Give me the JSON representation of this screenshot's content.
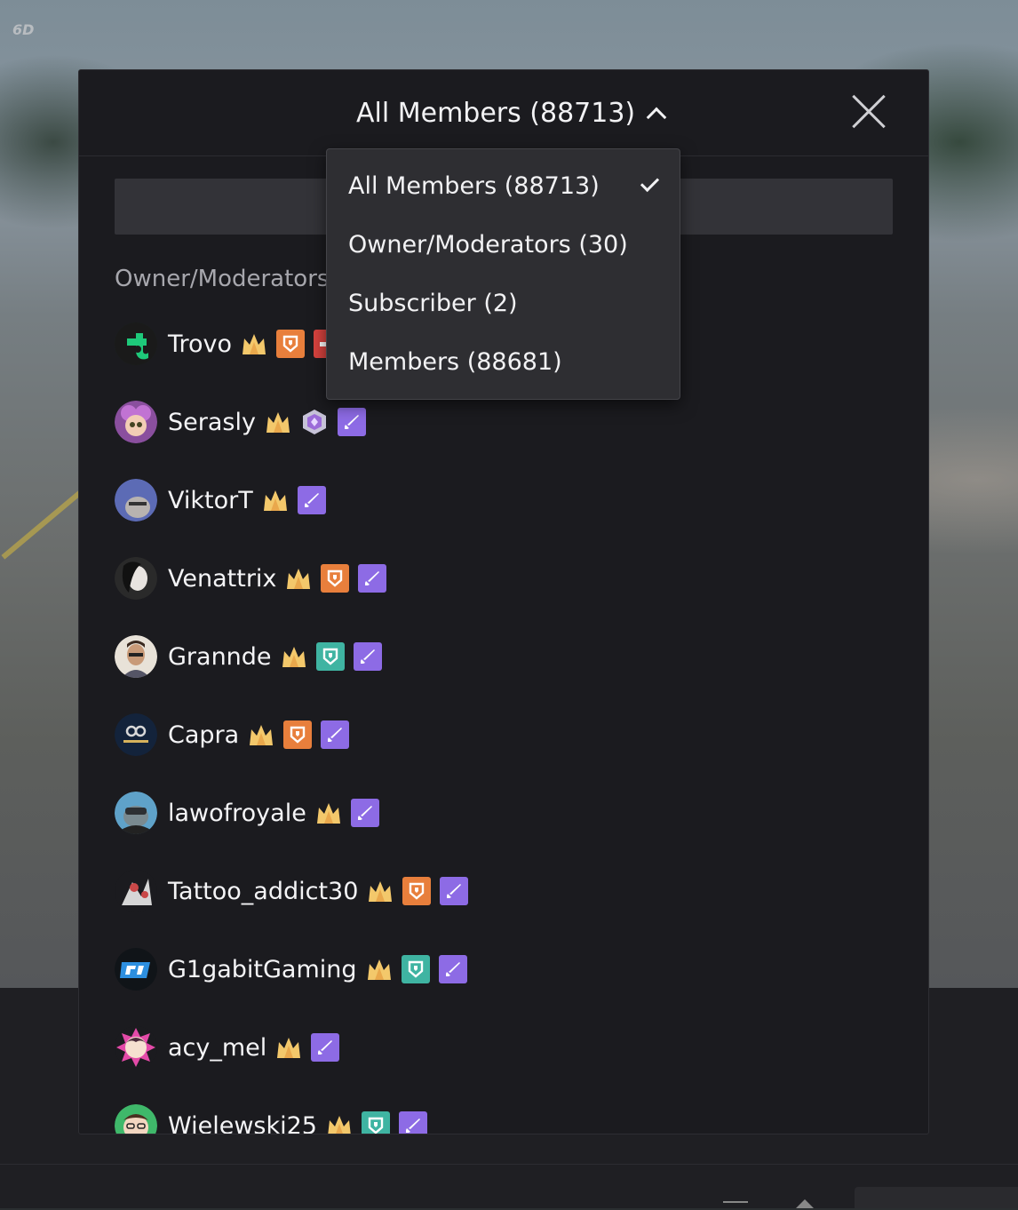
{
  "background": {
    "logo_text": "6D"
  },
  "modal": {
    "filter_label": "All Members (88713)",
    "section_title": "Owner/Moderators"
  },
  "dropdown": {
    "options": [
      {
        "label": "All Members (88713)",
        "selected": true
      },
      {
        "label": "Owner/Moderators (30)",
        "selected": false
      },
      {
        "label": "Subscriber (2)",
        "selected": false
      },
      {
        "label": "Members (88681)",
        "selected": false
      }
    ]
  },
  "members": [
    {
      "name": "Trovo",
      "badges": [
        "crown-icon",
        "subscriber-badge-orange",
        "red-badge"
      ]
    },
    {
      "name": "Serasly",
      "badges": [
        "crown-icon",
        "gem-badge",
        "moderator-badge"
      ]
    },
    {
      "name": "ViktorT",
      "badges": [
        "crown-icon",
        "moderator-badge"
      ]
    },
    {
      "name": "Venattrix",
      "badges": [
        "crown-icon",
        "subscriber-badge-orange",
        "moderator-badge"
      ]
    },
    {
      "name": "Grannde",
      "badges": [
        "crown-icon",
        "subscriber-badge-teal",
        "moderator-badge"
      ]
    },
    {
      "name": "Capra",
      "badges": [
        "crown-icon",
        "subscriber-badge-orange",
        "moderator-badge"
      ]
    },
    {
      "name": "lawofroyale",
      "badges": [
        "crown-icon",
        "moderator-badge"
      ]
    },
    {
      "name": "Tattoo_addict30",
      "badges": [
        "crown-icon",
        "subscriber-badge-orange",
        "moderator-badge"
      ]
    },
    {
      "name": "G1gabitGaming",
      "badges": [
        "crown-icon",
        "subscriber-badge-teal",
        "moderator-badge"
      ]
    },
    {
      "name": "acy_mel",
      "badges": [
        "crown-icon",
        "moderator-badge"
      ]
    },
    {
      "name": "Wielewski25",
      "badges": [
        "crown-icon",
        "subscriber-badge-teal",
        "moderator-badge"
      ]
    }
  ],
  "colors": {
    "subscriber_orange": "#e87f3c",
    "subscriber_teal": "#3fb4a2",
    "moderator_purple": "#8d6be5",
    "crown_gold": "#f3c86b"
  }
}
